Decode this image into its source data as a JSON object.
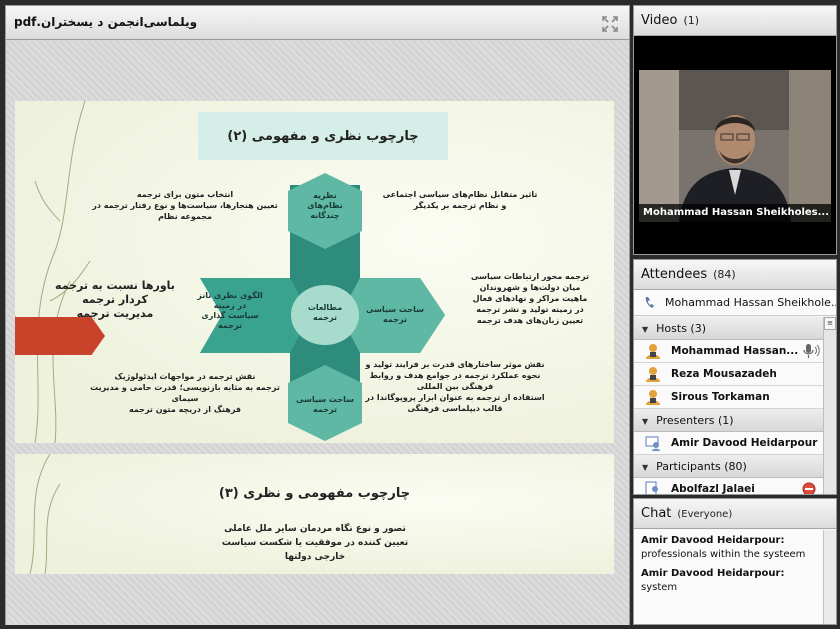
{
  "share_pod": {
    "title": "ویلماسی‌انجمن د یسختران.pdf"
  },
  "slide1": {
    "title": "چارچوب نظری و مفهومی (۲)",
    "top_left_text": "انتخاب متون برای ترجمه\nتعیین هنجارها، سیاست‌ها و نوع رفتار ترجمه در مجموعه نظام",
    "top_right_text": "تاثیر متقابل نظام‌های سیاسی اجتماعی\nو نظام ترجمه بر یکدیگر",
    "left_big_text": "باورها نسبت به ترجمه\nکردار ترجمه\nمدیریت ترجمه",
    "right_text": "ترجمه محور ارتباطات سیاسی\nمیان دولت‌ها و شهروندان\nماهیت مراکز و نهادهای فعال\nدر زمینه تولید و نشر ترجمه\nتعیین زبان‌های هدف ترجمه",
    "bottom_left_text": "نقش ترجمه در مواجهات ایدئولوژیک\nترجمه به مثابه بازنویسی؛ قدرت حامی و مدیریت سیمای\nفرهنگ از دریچه متون ترجمه",
    "bottom_right_text": "نقش موثر ساختارهای قدرت بر فرایند تولید و\nنحوه عملکرد ترجمه در جوامع هدف و روابط\nفرهنگی بین المللی\nاستفاده از ترجمه به عنوان ابزار پروپوگاندا در\nقالب دیپلماسی فرهنگی",
    "diagram": {
      "top": "نظریه\nنظام‌های\nچندگانه",
      "left": "الگوی نظری تانز\nدر زمینه\nسیاست گذاری\nترجمه",
      "center": "مطالعات\nترجمه",
      "right": "ساحت سیاسی\nترجمه",
      "bottom": "ساحت سیاسی\nترجمه"
    }
  },
  "slide2": {
    "title": "چارچوب مفهومی و نظری (۳)",
    "body": "تصور و نوع نگاه مردمان سایر ملل عاملی\nتعیین کننده در موفقیت یا شکست سیاست\nخارجی دولتها"
  },
  "video": {
    "title": "Video",
    "count": "(1)",
    "speaker_name": "Mohammad Hassan Sheikholes..."
  },
  "attendees": {
    "title": "Attendees",
    "count": "(84)",
    "current_user": "Mohammad Hassan Sheikhole...",
    "groups": [
      {
        "label": "Hosts (3)",
        "members": [
          "Mohammad Hassan...",
          "Reza Mousazadeh",
          "Sirous Torkaman"
        ]
      },
      {
        "label": "Presenters (1)",
        "members": [
          "Amir Davood Heidarpour"
        ]
      },
      {
        "label": "Participants (80)",
        "members": [
          "Abolfazl Jalaei"
        ]
      }
    ]
  },
  "chat": {
    "title": "Chat",
    "scope": "(Everyone)",
    "messages": [
      {
        "sender": "Amir Davood Heidarpour:",
        "text": "professionals within the systeem"
      },
      {
        "sender": "Amir Davood Heidarpour:",
        "text": "system"
      }
    ]
  },
  "colors": {
    "teal_dark": "#2d8c7c",
    "teal_mid": "#5fb8a3",
    "teal_light": "#a7dccc",
    "accent_red": "#c8432a"
  }
}
